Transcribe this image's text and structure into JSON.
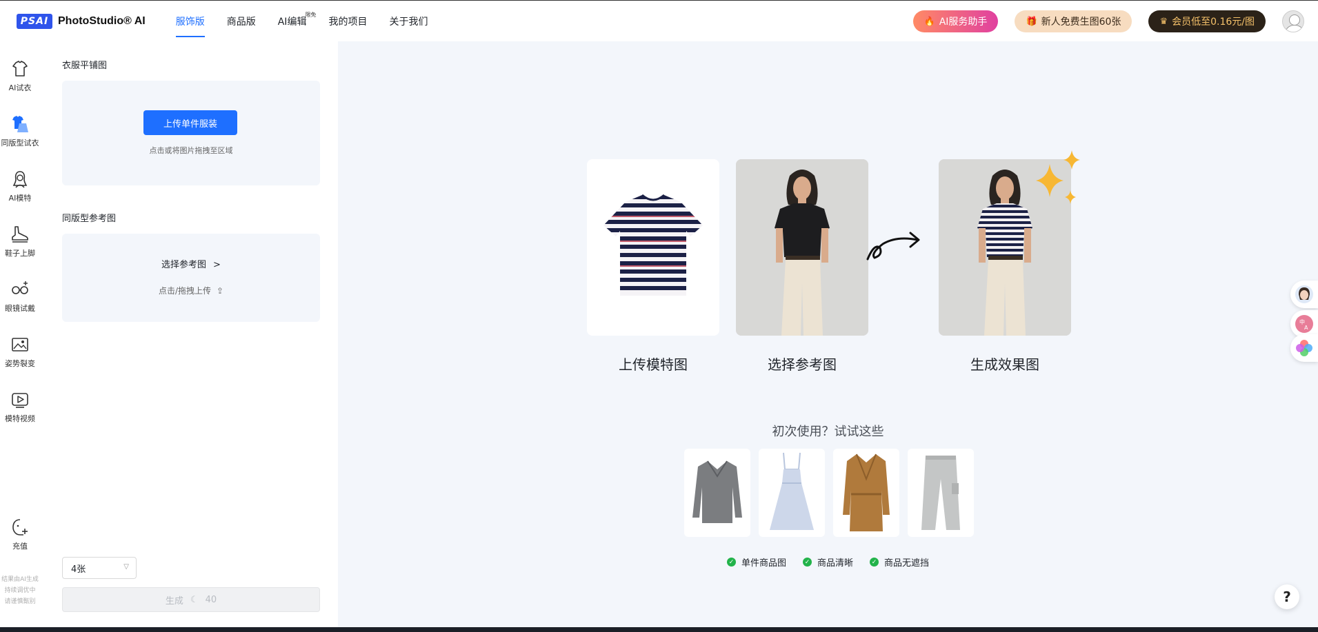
{
  "header": {
    "logo_mark": "PSAI",
    "logo_text": "PhotoStudio® AI",
    "nav": [
      {
        "label": "服饰版",
        "active": true
      },
      {
        "label": "商品版",
        "active": false
      },
      {
        "label": "AI编辑",
        "badge": "限免",
        "active": false
      },
      {
        "label": "我的项目",
        "active": false
      },
      {
        "label": "关于我们",
        "active": false
      }
    ],
    "ai_assistant": "AI服务助手",
    "free_promo": "新人免费生图60张",
    "vip_promo": "会员低至0.16元/图"
  },
  "rail": {
    "items": [
      {
        "label": "AI试衣",
        "icon": "tshirt-icon"
      },
      {
        "label": "同版型试衣",
        "icon": "same-style-tryon-icon"
      },
      {
        "label": "AI模特",
        "icon": "model-icon"
      },
      {
        "label": "鞋子上脚",
        "icon": "shoe-icon"
      },
      {
        "label": "眼镜试戴",
        "icon": "glasses-icon"
      },
      {
        "label": "姿势裂变",
        "icon": "image-icon"
      },
      {
        "label": "模特视频",
        "icon": "video-icon"
      }
    ],
    "recharge": "充值",
    "note_lines": [
      "结果由AI生成",
      "持续调优中",
      "请谨慎甄别"
    ]
  },
  "panel": {
    "clothing_title": "衣服平铺图",
    "upload_button": "上传单件服装",
    "upload_hint": "点击或将图片拖拽至区域",
    "reference_title": "同版型参考图",
    "choose_reference": "选择参考图",
    "reference_hint": "点击/拖拽上传",
    "count_value": "4张",
    "generate_label": "生成",
    "generate_cost": "40"
  },
  "main": {
    "steps": [
      "上传模特图",
      "选择参考图",
      "生成效果图"
    ],
    "try_title": "初次使用？试试这些",
    "samples": [
      "sweater",
      "dress",
      "coat",
      "pants"
    ],
    "checks": [
      "单件商品图",
      "商品清晰",
      "商品无遮挡"
    ]
  },
  "help": "?",
  "colors": {
    "accent": "#1e6fff",
    "panel_bg": "#f3f6fb",
    "check_green": "#22b34a",
    "vip_gold": "#f6c26a"
  }
}
